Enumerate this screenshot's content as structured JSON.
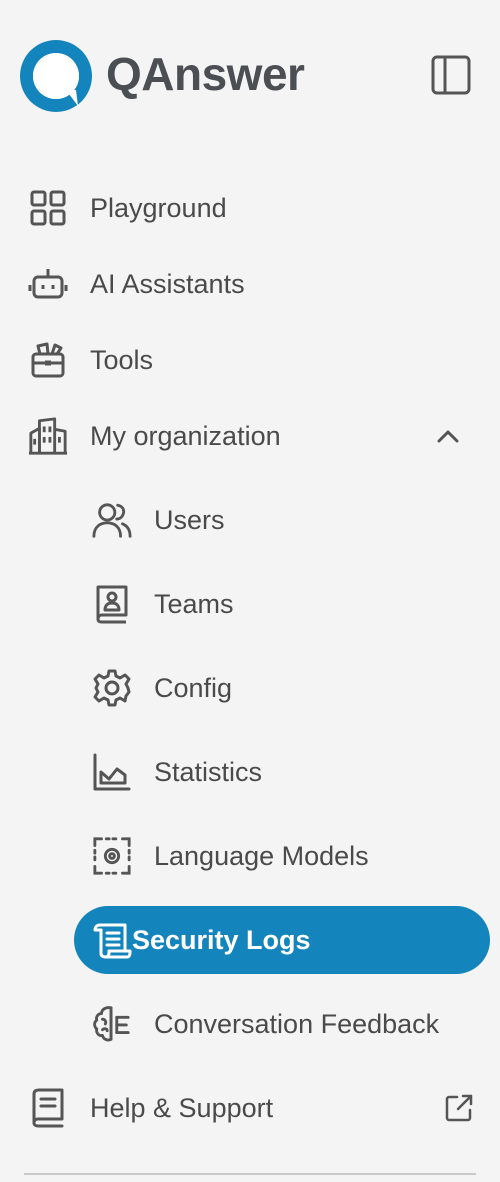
{
  "app": {
    "brand": "QAnswer"
  },
  "nav": {
    "playground": {
      "label": "Playground",
      "icon": "grid-icon"
    },
    "assistants": {
      "label": "AI Assistants",
      "icon": "robot-icon"
    },
    "tools": {
      "label": "Tools",
      "icon": "toolbox-icon"
    },
    "organization": {
      "label": "My organization",
      "icon": "building-icon",
      "expanded": true,
      "children": {
        "users": {
          "label": "Users",
          "icon": "users-icon"
        },
        "teams": {
          "label": "Teams",
          "icon": "contact-book-icon"
        },
        "config": {
          "label": "Config",
          "icon": "gear-icon"
        },
        "statistics": {
          "label": "Statistics",
          "icon": "chart-icon"
        },
        "language_models": {
          "label": "Language Models",
          "icon": "model-settings-icon"
        },
        "security_logs": {
          "label": "Security Logs",
          "icon": "scroll-icon",
          "active": true
        },
        "feedback": {
          "label": "Conversation Feedback",
          "icon": "brain-feedback-icon"
        }
      }
    },
    "help": {
      "label": "Help & Support",
      "icon": "book-icon",
      "external": true
    }
  },
  "colors": {
    "accent": "#1484bd",
    "background": "#f4f4f4",
    "text": "#4a4a4a",
    "brand_text": "#4b4f54"
  }
}
